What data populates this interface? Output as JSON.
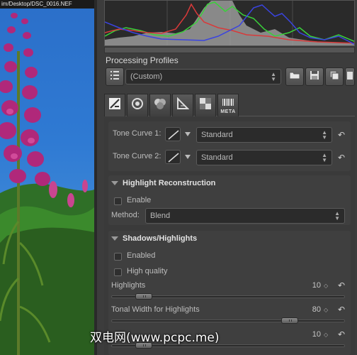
{
  "photo": {
    "title": "im/Desktop/DSC_0016.NEF"
  },
  "histogram": {
    "channels": [
      "red",
      "green",
      "blue",
      "luminance"
    ]
  },
  "profiles": {
    "title": "Processing Profiles",
    "selected": "(Custom)",
    "buttons": [
      "profile-list-icon",
      "open-folder-icon",
      "save-icon",
      "copy-icon",
      "paste-icon"
    ]
  },
  "tabs": [
    {
      "name": "exposure",
      "icon": "exposure-icon"
    },
    {
      "name": "detail",
      "icon": "detail-icon"
    },
    {
      "name": "color",
      "icon": "color-icon"
    },
    {
      "name": "transform",
      "icon": "transform-icon"
    },
    {
      "name": "raw",
      "icon": "raw-icon"
    },
    {
      "name": "metadata",
      "icon": "meta-icon",
      "label": "META"
    }
  ],
  "tone_curve": {
    "curve1_label": "Tone Curve 1:",
    "curve1_value": "Standard",
    "curve2_label": "Tone Curve 2:",
    "curve2_value": "Standard"
  },
  "highlight_reconstruction": {
    "title": "Highlight Reconstruction",
    "enable_label": "Enable",
    "method_label": "Method:",
    "method_value": "Blend"
  },
  "shadows_highlights": {
    "title": "Shadows/Highlights",
    "enabled_label": "Enabled",
    "high_quality_label": "High quality",
    "highlights_label": "Highlights",
    "highlights_value": "10",
    "tonal_width_label": "Tonal Width for Highlights",
    "tonal_width_value": "80",
    "shadows_value": "10"
  },
  "watermark": "双电网(www.pcpc.me)"
}
